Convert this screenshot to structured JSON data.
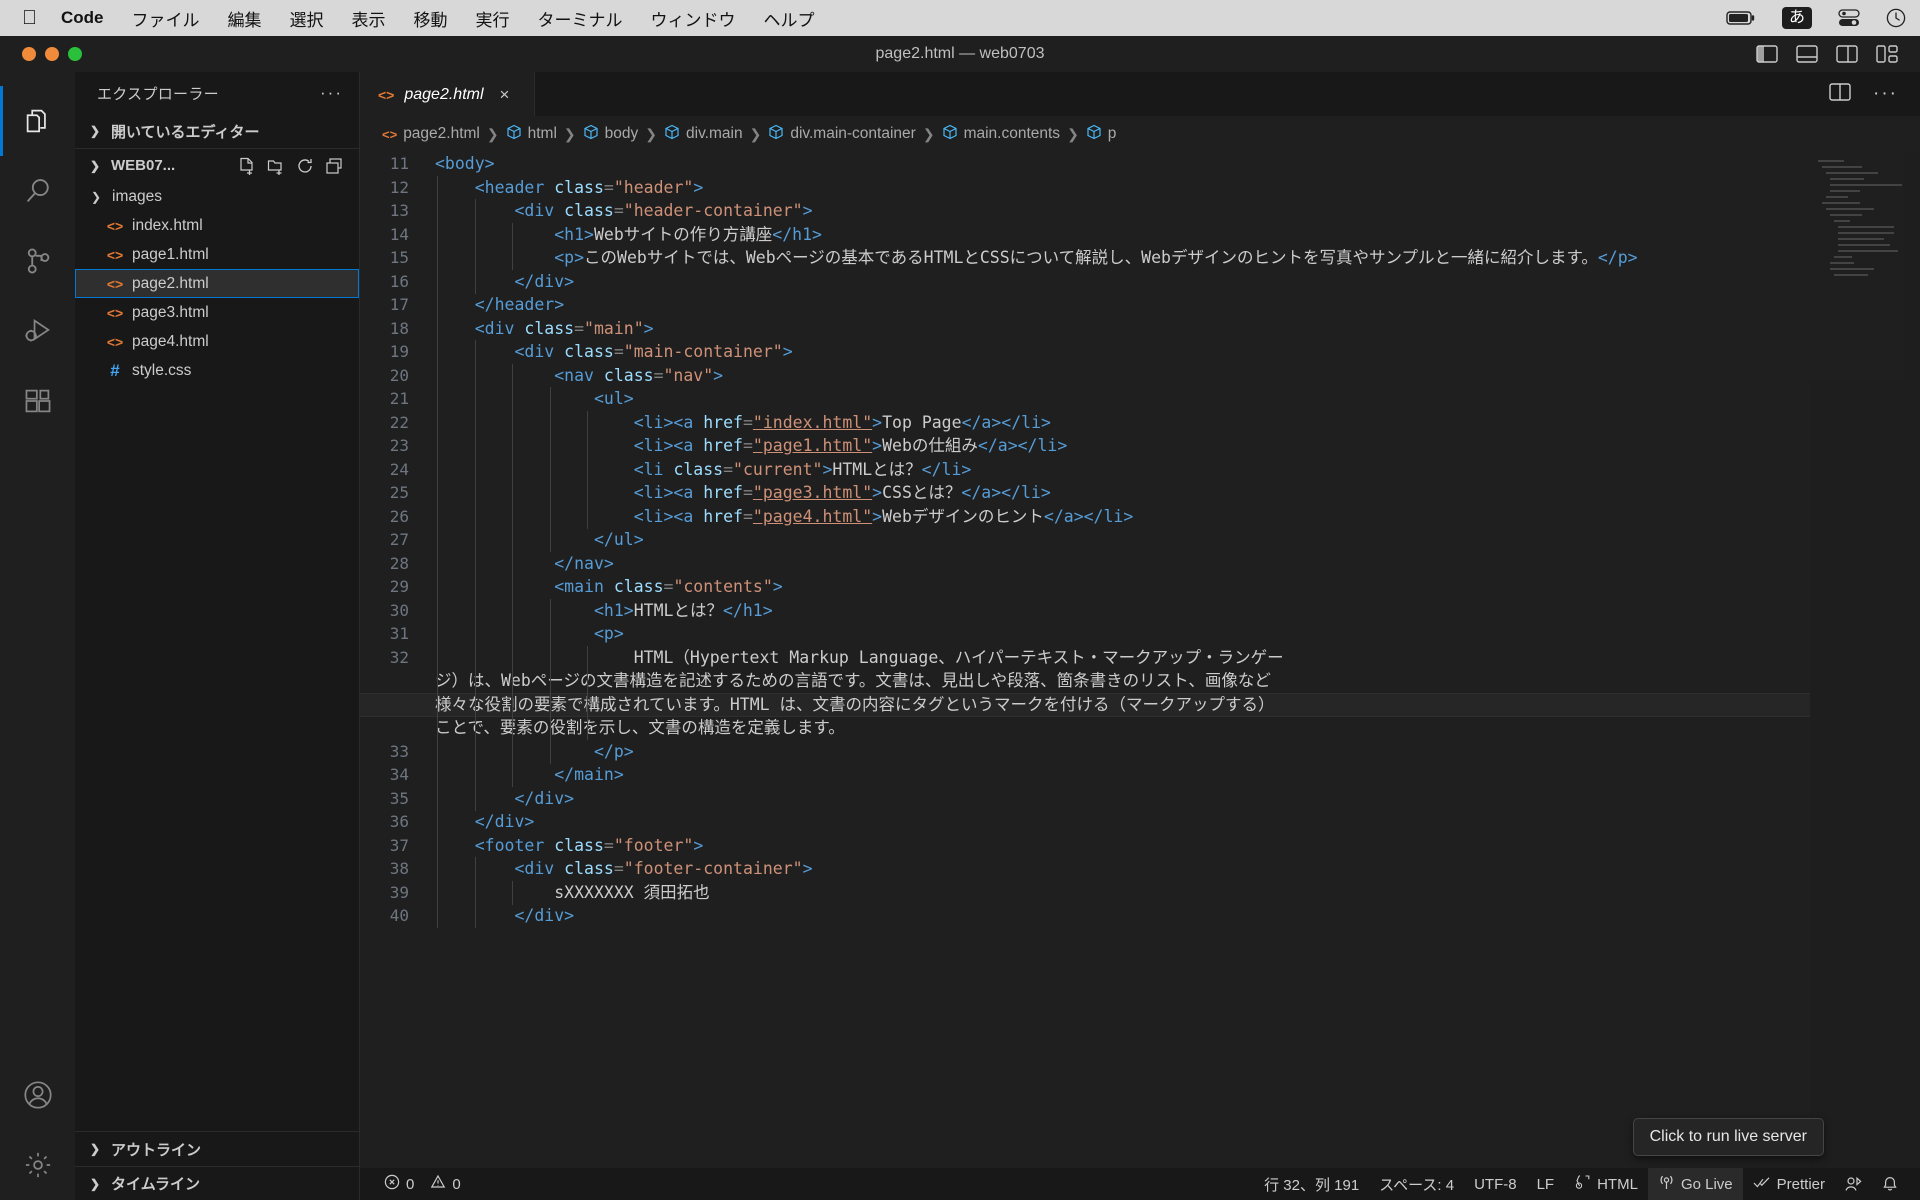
{
  "macbar": {
    "apple_icon": "apple-icon",
    "items": [
      {
        "label": "Code",
        "bold": true
      },
      {
        "label": "ファイル",
        "bold": false
      },
      {
        "label": "編集",
        "bold": false
      },
      {
        "label": "選択",
        "bold": false
      },
      {
        "label": "表示",
        "bold": false
      },
      {
        "label": "移動",
        "bold": false
      },
      {
        "label": "実行",
        "bold": false
      },
      {
        "label": "ターミナル",
        "bold": false
      },
      {
        "label": "ウィンドウ",
        "bold": false
      },
      {
        "label": "ヘルプ",
        "bold": false
      }
    ],
    "right": {
      "battery_icon": "battery-icon",
      "ime": "あ",
      "control_center_icon": "control-center-icon",
      "clock_icon": "clock-icon"
    }
  },
  "window": {
    "title": "page2.html — web0703",
    "layout_buttons": [
      "toggle-primary-sidebar",
      "toggle-panel",
      "toggle-secondary-sidebar",
      "customize-layout"
    ]
  },
  "activitybar": {
    "items": [
      {
        "name": "explorer",
        "active": true
      },
      {
        "name": "search",
        "active": false
      },
      {
        "name": "source-control",
        "active": false
      },
      {
        "name": "run-and-debug",
        "active": false
      },
      {
        "name": "extensions",
        "active": false
      }
    ],
    "bottom": [
      {
        "name": "accounts"
      },
      {
        "name": "manage-settings"
      }
    ]
  },
  "sidebar": {
    "title": "エクスプローラー",
    "more_actions": "···",
    "open_editors_label": "開いているエディター",
    "folder_label": "WEB07...",
    "folder_actions": [
      "new-file",
      "new-folder",
      "refresh-explorer",
      "collapse-folders"
    ],
    "files": [
      {
        "name": "images",
        "type": "folder",
        "icon": "chevron-right-icon",
        "selected": false
      },
      {
        "name": "index.html",
        "type": "html",
        "icon": "html-file-icon",
        "selected": false
      },
      {
        "name": "page1.html",
        "type": "html",
        "icon": "html-file-icon",
        "selected": false
      },
      {
        "name": "page2.html",
        "type": "html",
        "icon": "html-file-icon",
        "selected": true
      },
      {
        "name": "page3.html",
        "type": "html",
        "icon": "html-file-icon",
        "selected": false
      },
      {
        "name": "page4.html",
        "type": "html",
        "icon": "html-file-icon",
        "selected": false
      },
      {
        "name": "style.css",
        "type": "css",
        "icon": "css-file-icon",
        "selected": false
      }
    ],
    "outline_label": "アウトライン",
    "timeline_label": "タイムライン"
  },
  "editor": {
    "tab": {
      "label": "page2.html",
      "close": "×",
      "icon": "html-file-icon"
    },
    "tab_actions": [
      "split-editor",
      "more-actions"
    ],
    "breadcrumbs": [
      {
        "label": "page2.html",
        "icon": "html-file-icon"
      },
      {
        "label": "html",
        "icon": "symbol-cube-icon"
      },
      {
        "label": "body",
        "icon": "symbol-cube-icon"
      },
      {
        "label": "div.main",
        "icon": "symbol-cube-icon"
      },
      {
        "label": "div.main-container",
        "icon": "symbol-cube-icon"
      },
      {
        "label": "main.contents",
        "icon": "symbol-cube-icon"
      },
      {
        "label": "p",
        "icon": "symbol-cube-icon"
      }
    ],
    "lines": [
      {
        "n": "11",
        "indent": 0,
        "tokens": [
          [
            "tag",
            "<body>"
          ]
        ]
      },
      {
        "n": "12",
        "indent": 1,
        "tokens": [
          [
            "tag",
            "<header "
          ],
          [
            "attr",
            "class"
          ],
          [
            "punct",
            "="
          ],
          [
            "str",
            "\"header\""
          ],
          [
            "tag",
            ">"
          ]
        ]
      },
      {
        "n": "13",
        "indent": 2,
        "tokens": [
          [
            "tag",
            "<div "
          ],
          [
            "attr",
            "class"
          ],
          [
            "punct",
            "="
          ],
          [
            "str",
            "\"header-container\""
          ],
          [
            "tag",
            ">"
          ]
        ]
      },
      {
        "n": "14",
        "indent": 3,
        "tokens": [
          [
            "tag",
            "<h1>"
          ],
          [
            "txt",
            "Webサイトの作り方講座"
          ],
          [
            "tag",
            "</h1>"
          ]
        ]
      },
      {
        "n": "15",
        "indent": 3,
        "tokens": [
          [
            "tag",
            "<p>"
          ],
          [
            "txt",
            "このWebサイトでは、Webページの基本であるHTMLとCSSについて解説し、Webデザインのヒントを写真やサンプルと一緒に紹介します。"
          ],
          [
            "tag",
            "</p>"
          ]
        ]
      },
      {
        "n": "16",
        "indent": 2,
        "tokens": [
          [
            "tag",
            "</div>"
          ]
        ]
      },
      {
        "n": "17",
        "indent": 1,
        "tokens": [
          [
            "tag",
            "</header>"
          ]
        ]
      },
      {
        "n": "18",
        "indent": 1,
        "tokens": [
          [
            "tag",
            "<div "
          ],
          [
            "attr",
            "class"
          ],
          [
            "punct",
            "="
          ],
          [
            "str",
            "\"main\""
          ],
          [
            "tag",
            ">"
          ]
        ]
      },
      {
        "n": "19",
        "indent": 2,
        "tokens": [
          [
            "tag",
            "<div "
          ],
          [
            "attr",
            "class"
          ],
          [
            "punct",
            "="
          ],
          [
            "str",
            "\"main-container\""
          ],
          [
            "tag",
            ">"
          ]
        ]
      },
      {
        "n": "20",
        "indent": 3,
        "tokens": [
          [
            "tag",
            "<nav "
          ],
          [
            "attr",
            "class"
          ],
          [
            "punct",
            "="
          ],
          [
            "str",
            "\"nav\""
          ],
          [
            "tag",
            ">"
          ]
        ]
      },
      {
        "n": "21",
        "indent": 4,
        "tokens": [
          [
            "tag",
            "<ul>"
          ]
        ]
      },
      {
        "n": "22",
        "indent": 5,
        "tokens": [
          [
            "tag",
            "<li><a "
          ],
          [
            "attr",
            "href"
          ],
          [
            "punct",
            "="
          ],
          [
            "link",
            "\"index.html\""
          ],
          [
            "tag",
            ">"
          ],
          [
            "txt",
            "Top Page"
          ],
          [
            "tag",
            "</a></li>"
          ]
        ]
      },
      {
        "n": "23",
        "indent": 5,
        "tokens": [
          [
            "tag",
            "<li><a "
          ],
          [
            "attr",
            "href"
          ],
          [
            "punct",
            "="
          ],
          [
            "link",
            "\"page1.html\""
          ],
          [
            "tag",
            ">"
          ],
          [
            "txt",
            "Webの仕組み"
          ],
          [
            "tag",
            "</a></li>"
          ]
        ]
      },
      {
        "n": "24",
        "indent": 5,
        "tokens": [
          [
            "tag",
            "<li "
          ],
          [
            "attr",
            "class"
          ],
          [
            "punct",
            "="
          ],
          [
            "str",
            "\"current\""
          ],
          [
            "tag",
            ">"
          ],
          [
            "txt",
            "HTMLとは？"
          ],
          [
            "tag",
            "</li>"
          ]
        ]
      },
      {
        "n": "25",
        "indent": 5,
        "tokens": [
          [
            "tag",
            "<li><a "
          ],
          [
            "attr",
            "href"
          ],
          [
            "punct",
            "="
          ],
          [
            "link",
            "\"page3.html\""
          ],
          [
            "tag",
            ">"
          ],
          [
            "txt",
            "CSSとは？"
          ],
          [
            "tag",
            "</a></li>"
          ]
        ]
      },
      {
        "n": "26",
        "indent": 5,
        "tokens": [
          [
            "tag",
            "<li><a "
          ],
          [
            "attr",
            "href"
          ],
          [
            "punct",
            "="
          ],
          [
            "link",
            "\"page4.html\""
          ],
          [
            "tag",
            ">"
          ],
          [
            "txt",
            "Webデザインのヒント"
          ],
          [
            "tag",
            "</a></li>"
          ]
        ]
      },
      {
        "n": "27",
        "indent": 4,
        "tokens": [
          [
            "tag",
            "</ul>"
          ]
        ]
      },
      {
        "n": "28",
        "indent": 3,
        "tokens": [
          [
            "tag",
            "</nav>"
          ]
        ]
      },
      {
        "n": "29",
        "indent": 3,
        "tokens": [
          [
            "tag",
            "<main "
          ],
          [
            "attr",
            "class"
          ],
          [
            "punct",
            "="
          ],
          [
            "str",
            "\"contents\""
          ],
          [
            "tag",
            ">"
          ]
        ]
      },
      {
        "n": "30",
        "indent": 4,
        "tokens": [
          [
            "tag",
            "<h1>"
          ],
          [
            "txt",
            "HTMLとは？"
          ],
          [
            "tag",
            "</h1>"
          ]
        ]
      },
      {
        "n": "31",
        "indent": 4,
        "tokens": [
          [
            "tag",
            "<p>"
          ]
        ]
      },
      {
        "n": "32",
        "indent": 5,
        "wrap": true,
        "tokens": [
          [
            "txt",
            "HTML（Hypertext Markup Language、ハイパーテキスト・マークアップ・ランゲージ）は、Webページの文書構造を記述するための言語です。文書は、見出しや段落、箇条書きのリスト、画像など様々な役割の要素で構成されています。HTML は、文書の内容にタグというマークを付ける（マークアップする）ことで、要素の役割を示し、文書の構造を定義します。"
          ]
        ]
      },
      {
        "n": "33",
        "indent": 4,
        "tokens": [
          [
            "tag",
            "</p>"
          ]
        ]
      },
      {
        "n": "34",
        "indent": 3,
        "tokens": [
          [
            "tag",
            "</main>"
          ]
        ]
      },
      {
        "n": "35",
        "indent": 2,
        "tokens": [
          [
            "tag",
            "</div>"
          ]
        ]
      },
      {
        "n": "36",
        "indent": 1,
        "tokens": [
          [
            "tag",
            "</div>"
          ]
        ]
      },
      {
        "n": "37",
        "indent": 1,
        "tokens": [
          [
            "tag",
            "<footer "
          ],
          [
            "attr",
            "class"
          ],
          [
            "punct",
            "="
          ],
          [
            "str",
            "\"footer\""
          ],
          [
            "tag",
            ">"
          ]
        ]
      },
      {
        "n": "38",
        "indent": 2,
        "tokens": [
          [
            "tag",
            "<div "
          ],
          [
            "attr",
            "class"
          ],
          [
            "punct",
            "="
          ],
          [
            "str",
            "\"footer-container\""
          ],
          [
            "tag",
            ">"
          ]
        ]
      },
      {
        "n": "39",
        "indent": 3,
        "tokens": [
          [
            "txt",
            "sXXXXXXX 須田拓也"
          ]
        ]
      },
      {
        "n": "40",
        "indent": 2,
        "tokens": [
          [
            "tag",
            "</div>"
          ]
        ]
      }
    ],
    "tooltip": "Click to run live server"
  },
  "statusbar": {
    "errors": "0",
    "warnings": "0",
    "cursor": "行 32、列 191",
    "indent": "スペース: 4",
    "encoding": "UTF-8",
    "eol": "LF",
    "language": "HTML",
    "golive": "Go Live",
    "prettier": "Prettier",
    "icons": [
      "error-icon",
      "warning-icon",
      "braces-icon",
      "broadcast-icon",
      "checks-icon",
      "remote-icon",
      "bell-icon"
    ]
  },
  "colors": {
    "accent": "#0078d4",
    "tag": "#569cd6",
    "attr": "#9cdcfe",
    "string": "#ce9178",
    "html_icon": "#e37933",
    "css_icon": "#42a5f5"
  }
}
